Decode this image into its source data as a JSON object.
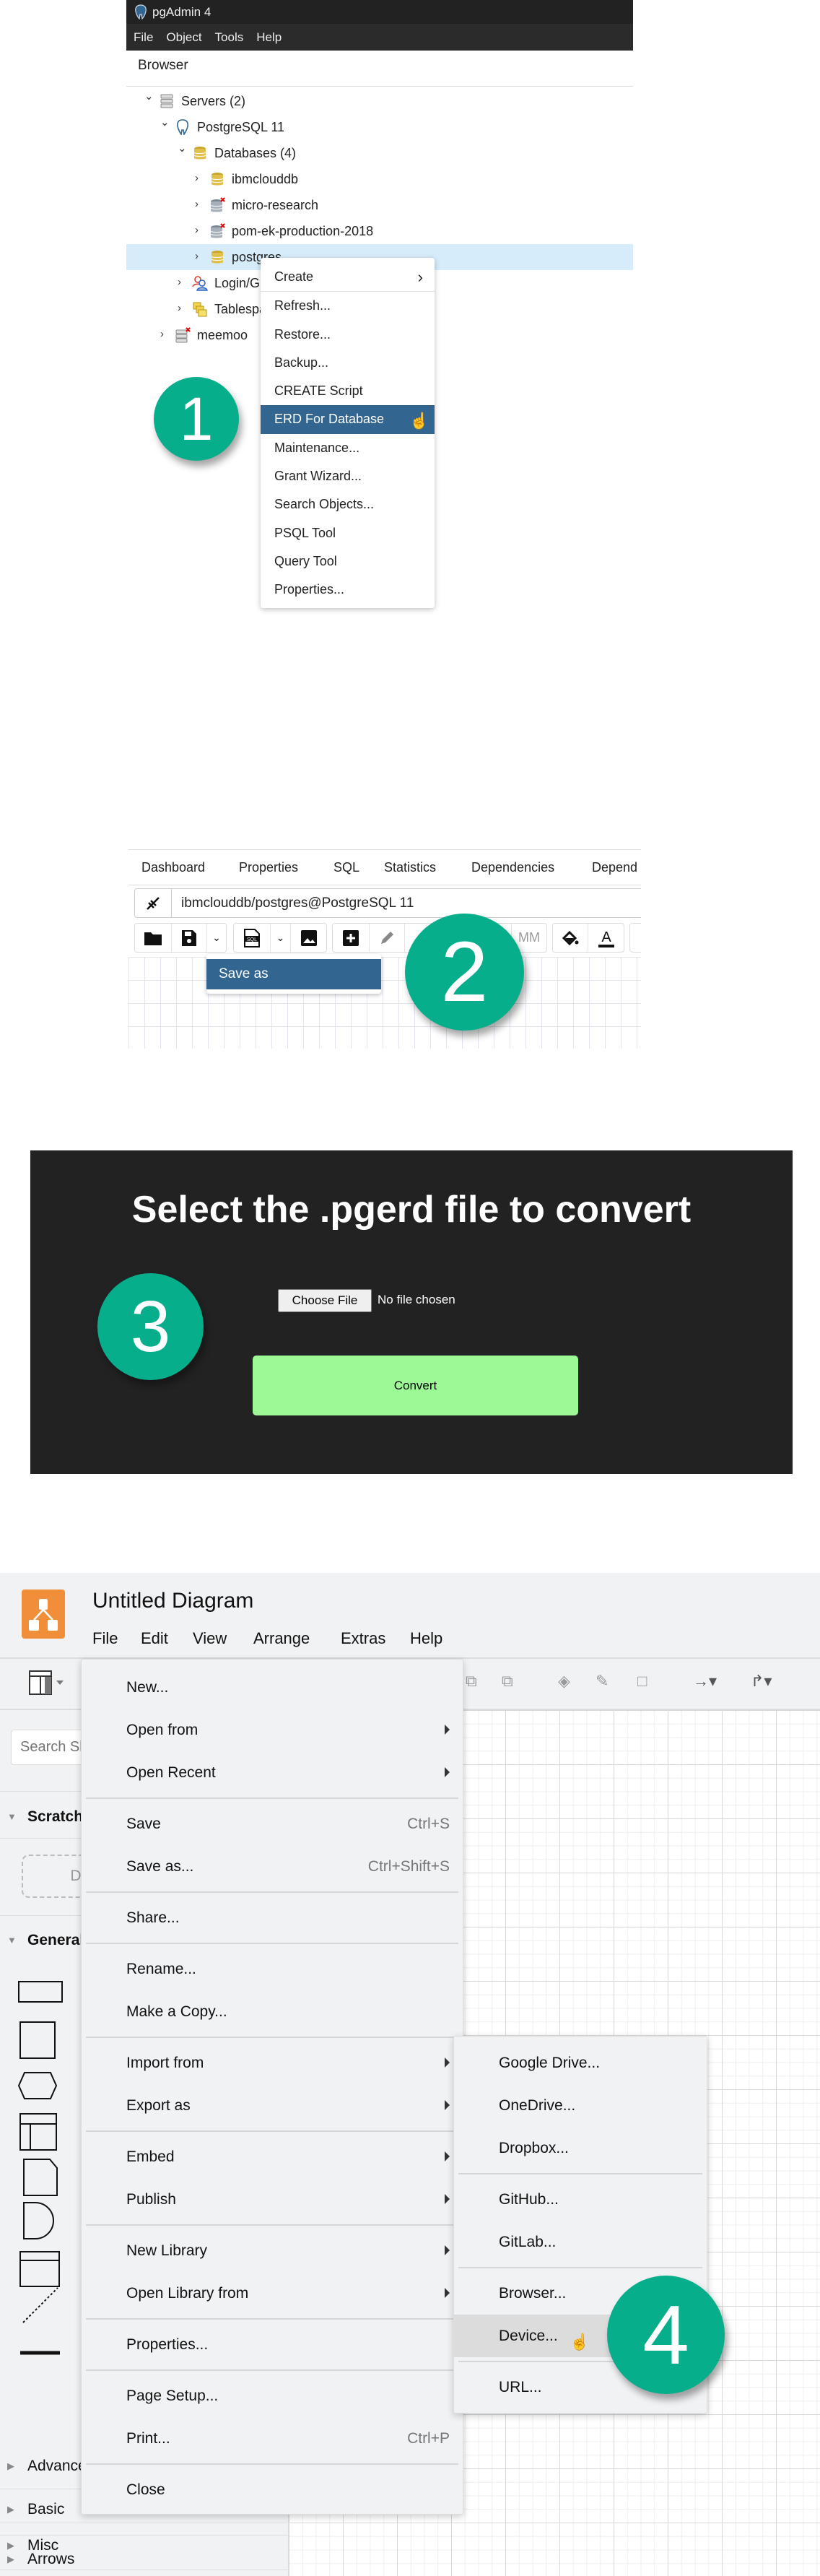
{
  "step1": {
    "badge": "1",
    "app_title": "pgAdmin 4",
    "menubar": [
      "File",
      "Object",
      "Tools",
      "Help"
    ],
    "browser_label": "Browser",
    "tree": [
      {
        "label": "Servers (2)",
        "level": 0,
        "expanded": true,
        "icon": "servers-icon"
      },
      {
        "label": "PostgreSQL 11",
        "level": 1,
        "expanded": true,
        "icon": "postgres-elephant-icon"
      },
      {
        "label": "Databases (4)",
        "level": 2,
        "expanded": true,
        "icon": "databases-icon"
      },
      {
        "label": "ibmclouddb",
        "level": 3,
        "expanded": false,
        "icon": "database-icon"
      },
      {
        "label": "micro-research",
        "level": 3,
        "expanded": false,
        "icon": "database-disconnected-icon"
      },
      {
        "label": "pom-ek-production-2018",
        "level": 3,
        "expanded": false,
        "icon": "database-disconnected-icon"
      },
      {
        "label": "postgres",
        "level": 3,
        "expanded": false,
        "icon": "database-icon",
        "selected": true
      },
      {
        "label": "Login/Group Roles",
        "level": 2,
        "expanded": false,
        "icon": "login-roles-icon"
      },
      {
        "label": "Tablespaces",
        "level": 2,
        "expanded": false,
        "icon": "tablespaces-icon"
      },
      {
        "label": "meemoo",
        "level": 1,
        "expanded": false,
        "icon": "server-disconnected-icon"
      }
    ],
    "context_menu": [
      {
        "label": "Create",
        "submenu": true
      },
      {
        "sep": true
      },
      {
        "label": "Refresh..."
      },
      {
        "label": "Restore..."
      },
      {
        "label": "Backup..."
      },
      {
        "label": "CREATE Script"
      },
      {
        "label": "ERD For Database",
        "highlighted": true
      },
      {
        "label": "Maintenance..."
      },
      {
        "label": "Grant Wizard..."
      },
      {
        "label": "Search Objects..."
      },
      {
        "label": "PSQL Tool"
      },
      {
        "label": "Query Tool"
      },
      {
        "label": "Properties..."
      }
    ]
  },
  "step2": {
    "badge": "2",
    "tabs": [
      "Dashboard",
      "Properties",
      "SQL",
      "Statistics",
      "Dependencies",
      "Depend"
    ],
    "connection": "ibmclouddb/postgres@PostgreSQL 11",
    "toolbar_mm": "MM",
    "save_dropdown": [
      "Save as"
    ]
  },
  "step3": {
    "badge": "3",
    "title": "Select the .pgerd file to convert",
    "choose_file": "Choose File",
    "no_file": "No file chosen",
    "convert": "Convert",
    "convert_color": "#9cf996"
  },
  "step4": {
    "badge": "4",
    "title": "Untitled Diagram",
    "menubar": [
      "File",
      "Edit",
      "View",
      "Arrange",
      "Extras",
      "Help"
    ],
    "search_placeholder": "Search Shapes",
    "sidebar_sections": [
      "Scratch",
      "General",
      "Misc",
      "Advanced",
      "Basic",
      "Arrows"
    ],
    "scratch_drop": "D",
    "file_menu": [
      {
        "label": "New..."
      },
      {
        "label": "Open from",
        "submenu": true
      },
      {
        "label": "Open Recent",
        "submenu": true
      },
      {
        "sep": true
      },
      {
        "label": "Save",
        "shortcut": "Ctrl+S"
      },
      {
        "label": "Save as...",
        "shortcut": "Ctrl+Shift+S"
      },
      {
        "sep": true
      },
      {
        "label": "Share..."
      },
      {
        "sep": true
      },
      {
        "label": "Rename..."
      },
      {
        "label": "Make a Copy..."
      },
      {
        "sep": true
      },
      {
        "label": "Import from",
        "submenu": true
      },
      {
        "label": "Export as",
        "submenu": true
      },
      {
        "sep": true
      },
      {
        "label": "Embed",
        "submenu": true
      },
      {
        "label": "Publish",
        "submenu": true
      },
      {
        "sep": true
      },
      {
        "label": "New Library",
        "submenu": true
      },
      {
        "label": "Open Library from",
        "submenu": true
      },
      {
        "sep": true
      },
      {
        "label": "Properties..."
      },
      {
        "sep": true
      },
      {
        "label": "Page Setup..."
      },
      {
        "label": "Print...",
        "shortcut": "Ctrl+P"
      },
      {
        "sep": true
      },
      {
        "label": "Close"
      }
    ],
    "import_submenu": [
      {
        "label": "Google Drive..."
      },
      {
        "label": "OneDrive..."
      },
      {
        "label": "Dropbox..."
      },
      {
        "sep": true
      },
      {
        "label": "GitHub..."
      },
      {
        "label": "GitLab..."
      },
      {
        "sep": true
      },
      {
        "label": "Browser..."
      },
      {
        "label": "Device...",
        "highlighted": true
      },
      {
        "sep": true
      },
      {
        "label": "URL..."
      }
    ]
  },
  "colors": {
    "badge": "#07ae8c",
    "pgadmin_highlight": "#326690",
    "drawio_logo": "#f08e3a"
  }
}
